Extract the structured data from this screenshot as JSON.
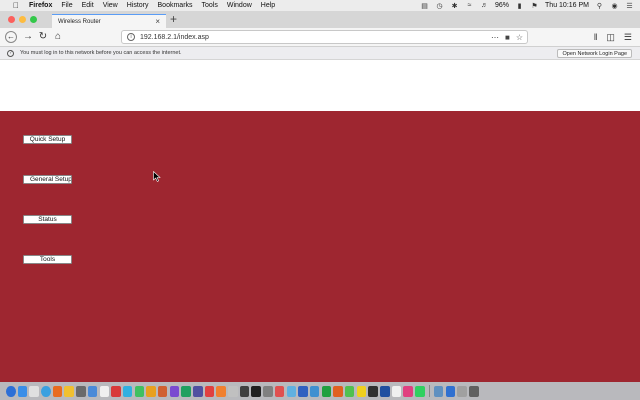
{
  "menubar": {
    "items": [
      "Firefox",
      "File",
      "Edit",
      "View",
      "History",
      "Bookmarks",
      "Tools",
      "Window",
      "Help"
    ],
    "battery": "96%",
    "clock": "Thu 10:16 PM"
  },
  "browser": {
    "tab_title": "Wireless Router",
    "new_tab_label": "+",
    "url": "192.168.2.1/index.asp",
    "notification": {
      "message": "You must log in to this network before you can access the internet.",
      "button_label": "Open Network Login Page"
    }
  },
  "page": {
    "buttons": [
      "Quick Setup",
      "General Setup",
      "Status",
      "Tools"
    ],
    "colors": {
      "header_bg": "#ffffff",
      "body_bg": "#9e2630",
      "button_bg": "#ffffff"
    }
  },
  "icons": {
    "traffic_lights": [
      "close-icon",
      "minimize-icon",
      "zoom-icon"
    ],
    "dock_colors": [
      "#2d6fd6",
      "#3a8ee8",
      "#e0e0e0",
      "#3aa0e0",
      "#e86b1f",
      "#f0c030",
      "#6a6a6a",
      "#4a8ad8",
      "#f0f0f0",
      "#d83a3a",
      "#30b0e0",
      "#40c060",
      "#e8a020",
      "#d06030",
      "#7a4ad0",
      "#20a060",
      "#5050a0",
      "#e04040",
      "#f08030",
      "#c0c0c0",
      "#404040",
      "#202020",
      "#808080",
      "#e05050",
      "#60b0e0",
      "#3060c0",
      "#4090d0",
      "#20a040",
      "#e06020",
      "#50c050",
      "#f0d020",
      "#303030",
      "#2050a0",
      "#f0f0f0",
      "#e04080",
      "#30d060",
      "#6090c0",
      "#3070d0",
      "#a0a0a0",
      "#606060"
    ]
  }
}
